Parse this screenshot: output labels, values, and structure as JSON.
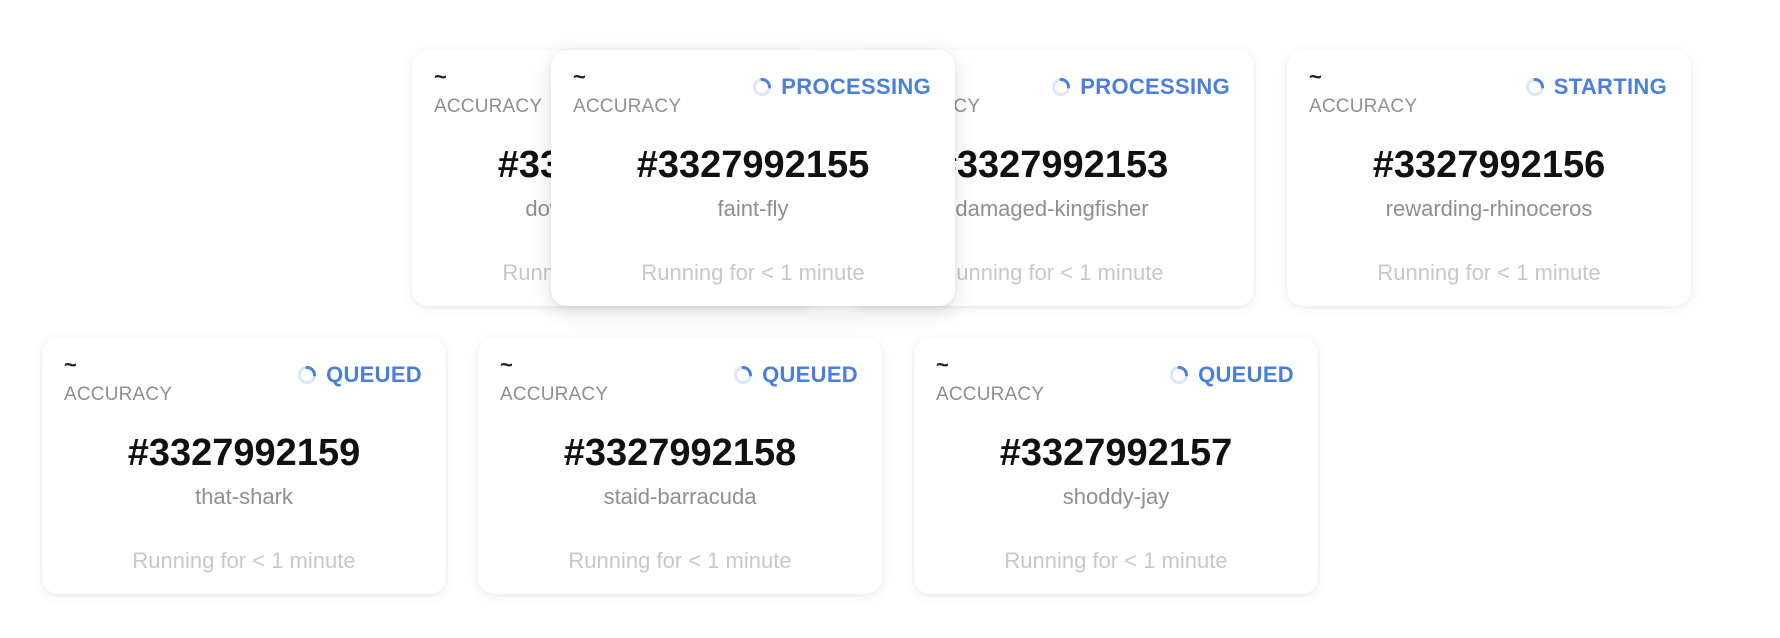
{
  "cards": [
    {
      "metric_value": "~",
      "metric_label": "ACCURACY",
      "status": "",
      "run_id": "#3327992154",
      "run_name": "downy-nightingale",
      "time_text": "Running for < 1 minute"
    },
    {
      "metric_value": "~",
      "metric_label": "ACCURACY",
      "status": "PROCESSING",
      "run_id": "#3327992153",
      "run_name": "damaged-kingfisher",
      "time_text": "Running for < 1 minute"
    },
    {
      "metric_value": "~",
      "metric_label": "ACCURACY",
      "status": "PROCESSING",
      "run_id": "#3327992155",
      "run_name": "faint-fly",
      "time_text": "Running for < 1 minute"
    },
    {
      "metric_value": "~",
      "metric_label": "ACCURACY",
      "status": "STARTING",
      "run_id": "#3327992156",
      "run_name": "rewarding-rhinoceros",
      "time_text": "Running for < 1 minute"
    },
    {
      "metric_value": "~",
      "metric_label": "ACCURACY",
      "status": "QUEUED",
      "run_id": "#3327992159",
      "run_name": "that-shark",
      "time_text": "Running for < 1 minute"
    },
    {
      "metric_value": "~",
      "metric_label": "ACCURACY",
      "status": "QUEUED",
      "run_id": "#3327992158",
      "run_name": "staid-barracuda",
      "time_text": "Running for < 1 minute"
    },
    {
      "metric_value": "~",
      "metric_label": "ACCURACY",
      "status": "QUEUED",
      "run_id": "#3327992157",
      "run_name": "shoddy-jay",
      "time_text": "Running for < 1 minute"
    }
  ],
  "colors": {
    "status": "#4a7fe0",
    "spinner_track": "#dce6f8"
  },
  "icons": {
    "status_spinner": "loading-spinner-icon"
  }
}
